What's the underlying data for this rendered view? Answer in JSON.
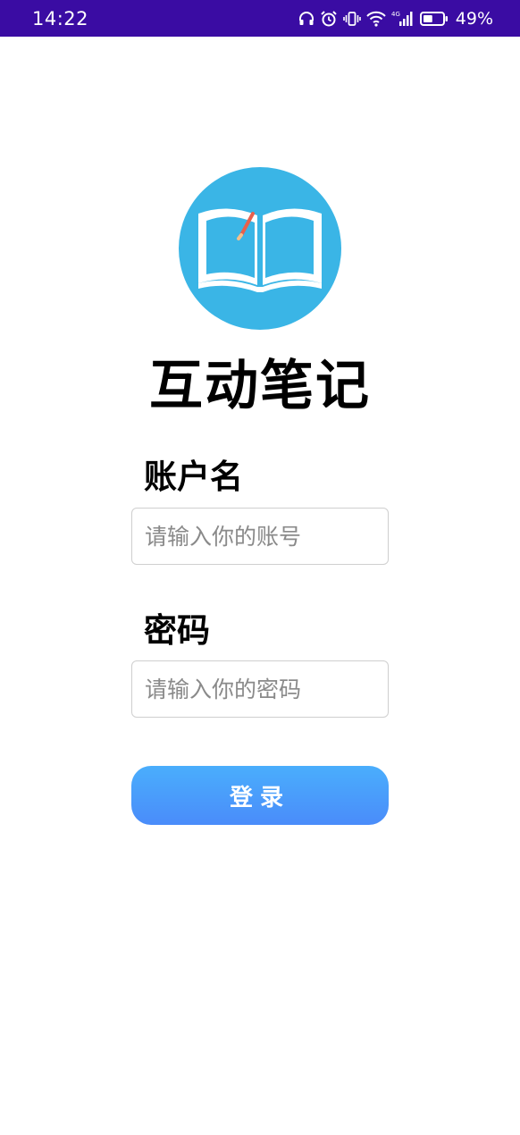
{
  "status_bar": {
    "time": "14:22",
    "network_label": "4G",
    "battery_percent": "49%",
    "battery_level": 0.49,
    "icons": [
      "headphones-icon",
      "alarm-icon",
      "vibrate-icon",
      "wifi-icon",
      "cellular-signal-icon",
      "battery-icon"
    ]
  },
  "app": {
    "logo_icon": "open-book-icon",
    "title": "互动笔记"
  },
  "login_form": {
    "account_label": "账户名",
    "account_placeholder": "请输入你的账号",
    "account_value": "",
    "password_label": "密码",
    "password_placeholder": "请输入你的密码",
    "password_value": "",
    "login_button_label": "登录"
  },
  "colors": {
    "status_bar_bg": "#3a0ca3",
    "logo_circle": "#3ab5e6",
    "button_gradient_top": "#4aaefc",
    "button_gradient_bottom": "#4a8cfa"
  }
}
